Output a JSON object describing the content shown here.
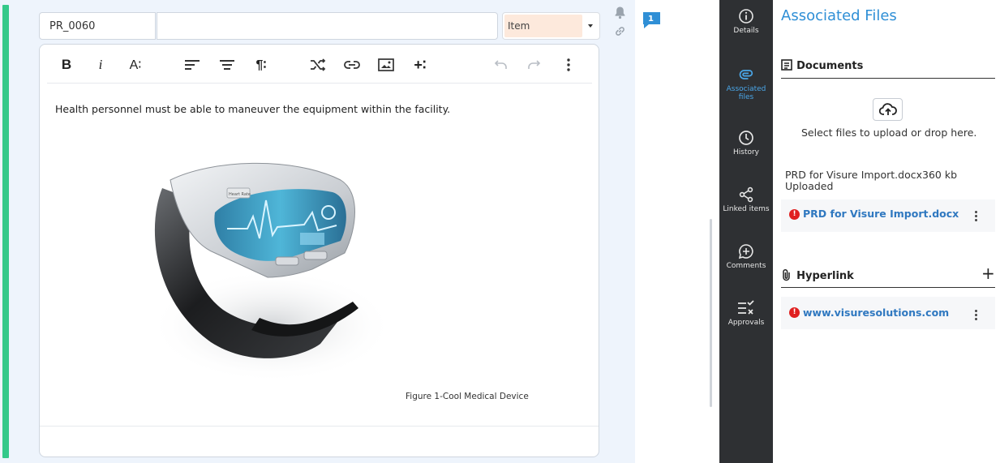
{
  "item": {
    "id": "PR_0060",
    "title_value": "",
    "type": "Item"
  },
  "comments": {
    "count": "1"
  },
  "toolbar": {
    "bold": "B",
    "italic": "i",
    "font_size": "A∶",
    "paragraph": "¶∶",
    "insert": "+∶"
  },
  "content": {
    "body": "Health personnel must be able to maneuver the equipment within the facility.",
    "caption": "Figure 1-Cool Medical Device",
    "screen_label": "Heart Rate"
  },
  "sidenav": {
    "items": [
      {
        "label": "Details",
        "icon": "info-icon"
      },
      {
        "label": "Associated files",
        "icon": "paperclip-icon",
        "active": true
      },
      {
        "label": "History",
        "icon": "clock-icon"
      },
      {
        "label": "Linked items",
        "icon": "share-icon"
      },
      {
        "label": "Comments",
        "icon": "comment-plus-icon"
      },
      {
        "label": "Approvals",
        "icon": "checklist-icon"
      }
    ]
  },
  "panel": {
    "title": "Associated Files",
    "documents": {
      "header": "Documents",
      "upload_hint": "Select files to upload or drop here.",
      "status_line1": "PRD for Visure Import.docx360 kb",
      "status_line2": "Uploaded",
      "file_name": "PRD for Visure Import.docx"
    },
    "hyperlink": {
      "header": "Hyperlink",
      "add": "+",
      "url": "www.visuresolutions.com"
    }
  },
  "colors": {
    "accent": "#2f8fd6",
    "status_bar": "#34c98a",
    "error": "#e02020",
    "sidenav_bg": "#2e3033",
    "type_bg": "#fde9dc"
  }
}
